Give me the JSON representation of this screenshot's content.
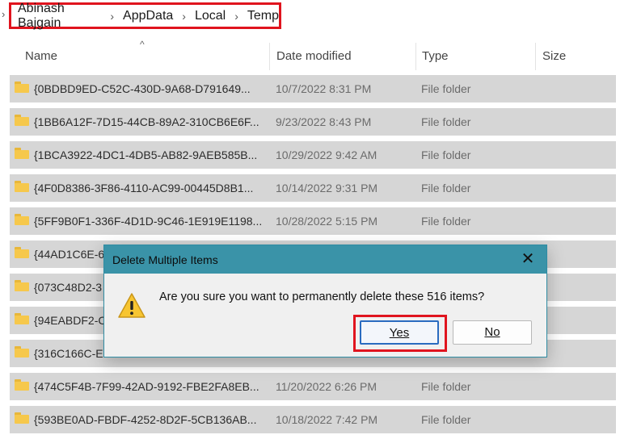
{
  "breadcrumb": {
    "lead_chevron": "›",
    "items": [
      "Abinash Bajgain",
      "AppData",
      "Local",
      "Temp"
    ],
    "separator": "›"
  },
  "columns": {
    "name": "Name",
    "date_modified": "Date modified",
    "type": "Type",
    "size": "Size",
    "sort_indicator": "^"
  },
  "rows": [
    {
      "name": "{0BDBD9ED-C52C-430D-9A68-D791649...",
      "date": "10/7/2022 8:31 PM",
      "type": "File folder"
    },
    {
      "name": "{1BB6A12F-7D15-44CB-89A2-310CB6E6F...",
      "date": "9/23/2022 8:43 PM",
      "type": "File folder"
    },
    {
      "name": "{1BCA3922-4DC1-4DB5-AB82-9AEB585B...",
      "date": "10/29/2022 9:42 AM",
      "type": "File folder"
    },
    {
      "name": "{4F0D8386-3F86-4110-AC99-00445D8B1...",
      "date": "10/14/2022 9:31 PM",
      "type": "File folder"
    },
    {
      "name": "{5FF9B0F1-336F-4D1D-9C46-1E919E1198...",
      "date": "10/28/2022 5:15 PM",
      "type": "File folder"
    },
    {
      "name": "{44AD1C6E-6",
      "date": "",
      "type": ""
    },
    {
      "name": "{073C48D2-3",
      "date": "",
      "type": ""
    },
    {
      "name": "{94EABDF2-C",
      "date": "",
      "type": ""
    },
    {
      "name": "{316C166C-E",
      "date": "",
      "type": ""
    },
    {
      "name": "{474C5F4B-7F99-42AD-9192-FBE2FA8EB...",
      "date": "11/20/2022 6:26 PM",
      "type": "File folder"
    },
    {
      "name": "{593BE0AD-FBDF-4252-8D2F-5CB136AB...",
      "date": "10/18/2022 7:42 PM",
      "type": "File folder"
    }
  ],
  "dialog": {
    "title": "Delete Multiple Items",
    "close_glyph": "✕",
    "message": "Are you sure you want to permanently delete these 516 items?",
    "yes_label": "Yes",
    "no_label": "No",
    "icon": "warning-icon"
  },
  "colors": {
    "highlight": "#e0141e",
    "dialog_title_bar": "#3a93a8",
    "row_selected": "#d6d6d6",
    "folder": "#f6c84c"
  }
}
